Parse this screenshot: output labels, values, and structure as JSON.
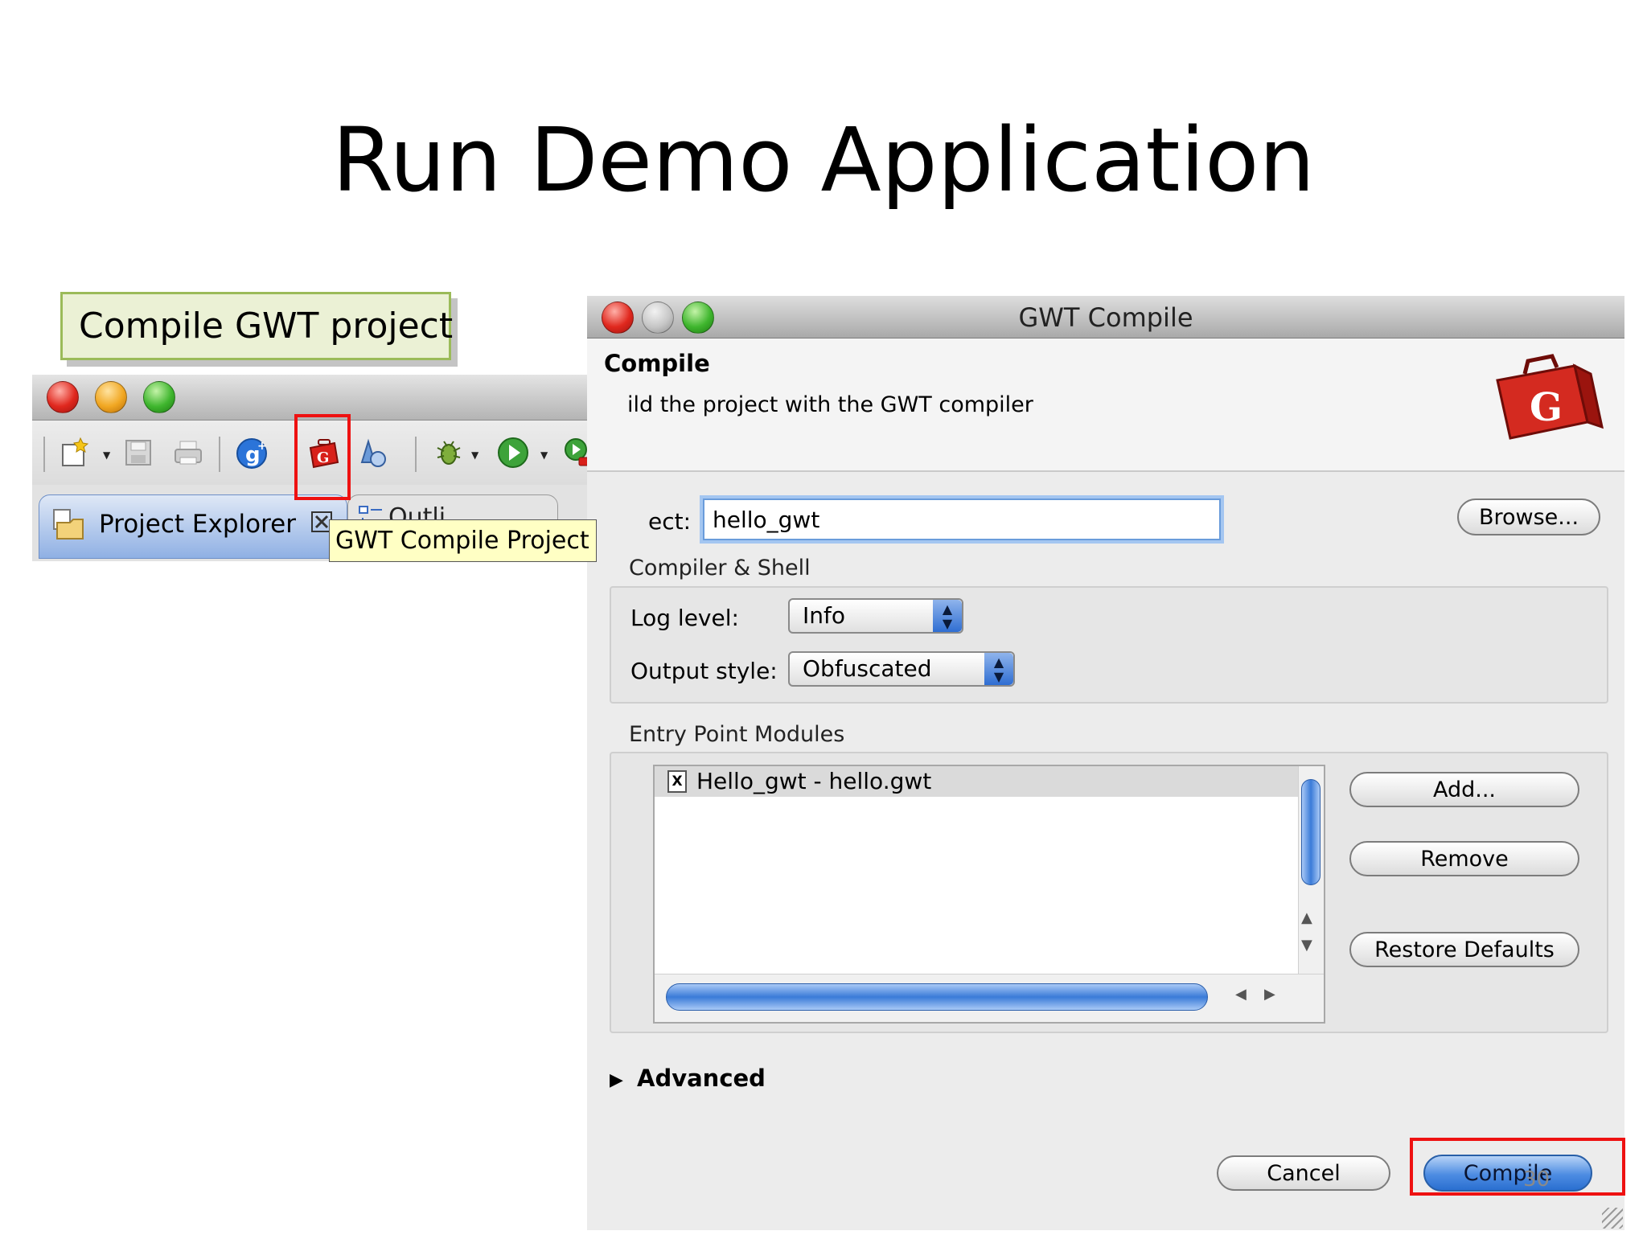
{
  "slide": {
    "title": "Run Demo Application",
    "callout": "Compile GWT project",
    "page_number": "30"
  },
  "eclipse": {
    "tabs": {
      "project_explorer": "Project Explorer",
      "outline": "Outli"
    },
    "tooltip": "GWT Compile Project"
  },
  "dialog": {
    "title": "GWT Compile",
    "heading": "Compile",
    "description": "ild the project with the GWT compiler",
    "project_label": "ect:",
    "project_value": "hello_gwt",
    "browse_label": "Browse...",
    "compiler_group": {
      "title": "Compiler & Shell",
      "log_level_label": "Log level:",
      "log_level_value": "Info",
      "output_style_label": "Output style:",
      "output_style_value": "Obfuscated"
    },
    "entry_group": {
      "title": "Entry Point Modules",
      "modules": [
        "Hello_gwt - hello.gwt"
      ],
      "add_label": "Add...",
      "remove_label": "Remove",
      "restore_label": "Restore Defaults"
    },
    "advanced_label": "Advanced",
    "cancel_label": "Cancel",
    "compile_label": "Compile"
  },
  "colors": {
    "highlight_border": "#ee1111",
    "callout_fill": "#ebf1d5",
    "callout_border": "#9bbb59",
    "default_button": "#4d8ce2"
  }
}
